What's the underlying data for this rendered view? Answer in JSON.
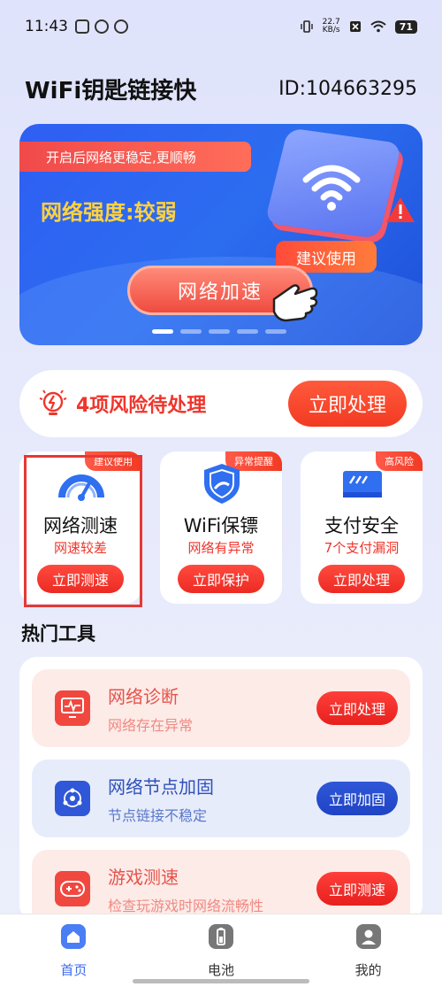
{
  "status_bar": {
    "time": "11:43",
    "net_speed_value": "22.7",
    "net_speed_unit": "KB/s",
    "battery": "71"
  },
  "header": {
    "app_title": "WiFi钥匙链接快",
    "user_id": "ID:104663295"
  },
  "banner": {
    "tag": "开启后网络更稳定,更顺畅",
    "signal_text": "网络强度:较弱",
    "suggest": "建议使用",
    "speedup_button": "网络加速"
  },
  "risk": {
    "text": "4项风险待处理",
    "button": "立即处理"
  },
  "features": [
    {
      "badge": "建议使用",
      "title": "网络测速",
      "subtitle": "网速较差",
      "button": "立即测速"
    },
    {
      "badge": "异常提醒",
      "title": "WiFi保镖",
      "subtitle": "网络有异常",
      "button": "立即保护"
    },
    {
      "badge": "高风险",
      "title": "支付安全",
      "subtitle": "7个支付漏洞",
      "button": "立即处理"
    }
  ],
  "hot_tools": {
    "title": "热门工具",
    "items": [
      {
        "title": "网络诊断",
        "subtitle": "网络存在异常",
        "button": "立即处理"
      },
      {
        "title": "网络节点加固",
        "subtitle": "节点链接不稳定",
        "button": "立即加固"
      },
      {
        "title": "游戏测速",
        "subtitle": "检查玩游戏时网络流畅性",
        "button": "立即测速"
      }
    ]
  },
  "bottom_nav": {
    "items": [
      {
        "label": "首页",
        "icon": "home-icon"
      },
      {
        "label": "电池",
        "icon": "battery-icon"
      },
      {
        "label": "我的",
        "icon": "profile-icon"
      }
    ]
  },
  "colors": {
    "accent_red": "#f0352b",
    "accent_blue": "#2f5ef3",
    "signal_yellow": "#ffd23f"
  }
}
